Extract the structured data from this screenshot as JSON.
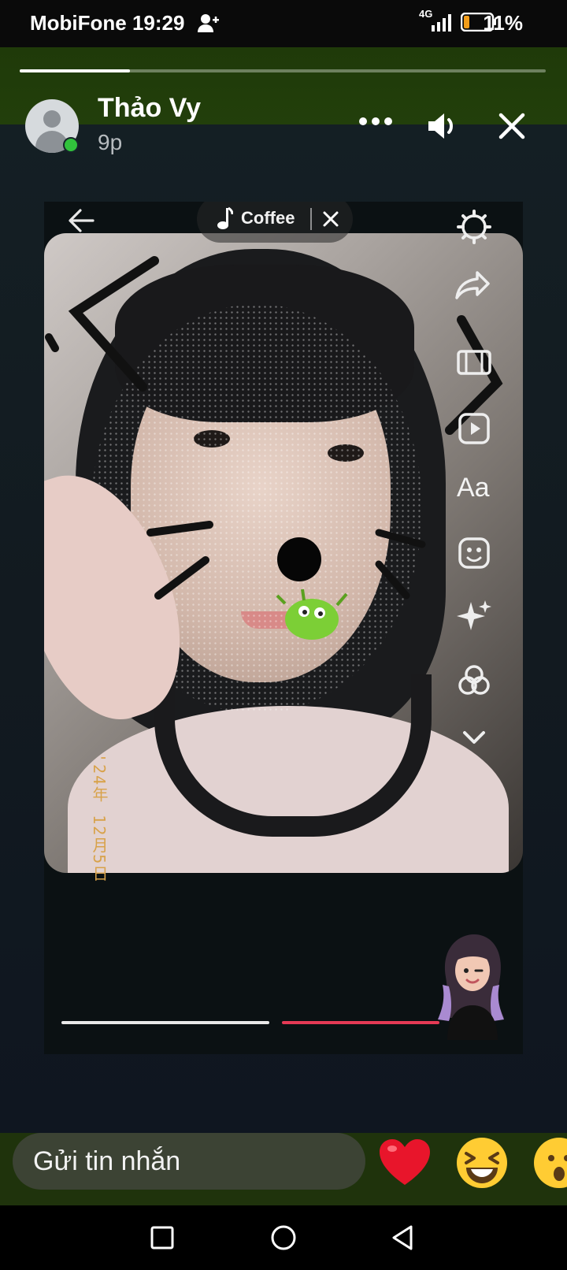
{
  "status_bar": {
    "carrier_time": "MobiFone 19:29",
    "network": "4G",
    "battery": "11%"
  },
  "story_header": {
    "progress_fraction": 0.21,
    "username": "Thảo Vy",
    "time_ago": "9p",
    "online": true,
    "icons": [
      "more-icon",
      "sound-icon",
      "close-icon"
    ]
  },
  "story": {
    "music_title": "Coffee",
    "date_stamp": "'24年 12月5日",
    "tools": [
      "settings-icon",
      "share-icon",
      "flip-icon",
      "video-icon",
      "text-tool",
      "sticker-icon",
      "effects-icon",
      "filters-icon",
      "chevron-down-icon"
    ],
    "text_tool_label": "Aa"
  },
  "reply_bar": {
    "placeholder": "Gửi tin nhắn",
    "reactions": [
      "❤️",
      "😆",
      "😮"
    ]
  },
  "nav": [
    "recents-button",
    "home-button",
    "back-button"
  ],
  "colors": {
    "header_green": "#223f0b",
    "online_green": "#31c23c",
    "accent_red": "#e53a55"
  }
}
